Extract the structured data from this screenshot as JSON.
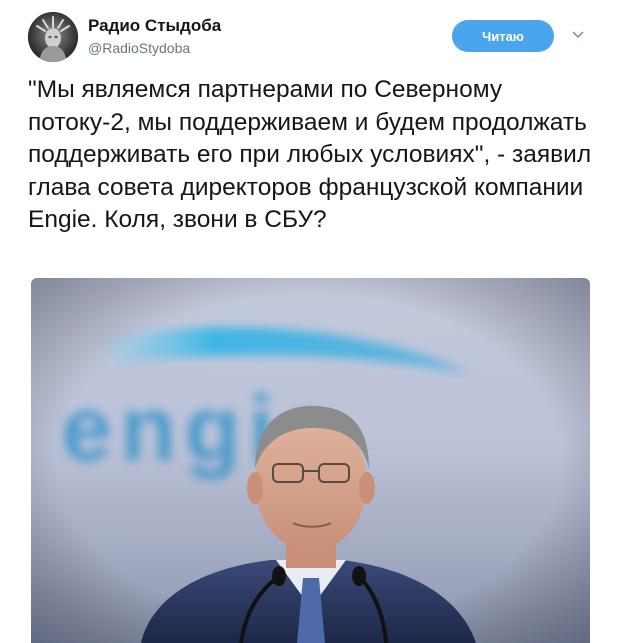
{
  "tweet": {
    "display_name": "Радио Стыдоба",
    "handle": "@RadioStydoba",
    "follow_label": "Читаю",
    "text": "\"Мы являемся партнерами по Северному потоку-2, мы поддерживаем и будем продолжать поддерживать его при любых условиях\", - заявил глава совета директоров французской компании Engie. Коля, звони в СБУ?"
  },
  "icons": {
    "avatar": "statue-of-liberty-avatar",
    "caret": "chevron-down-icon"
  },
  "photo": {
    "logo_text": "engie"
  },
  "colors": {
    "follow_button": "#4aa5ec",
    "handle": "#657786",
    "text": "#14171a"
  }
}
